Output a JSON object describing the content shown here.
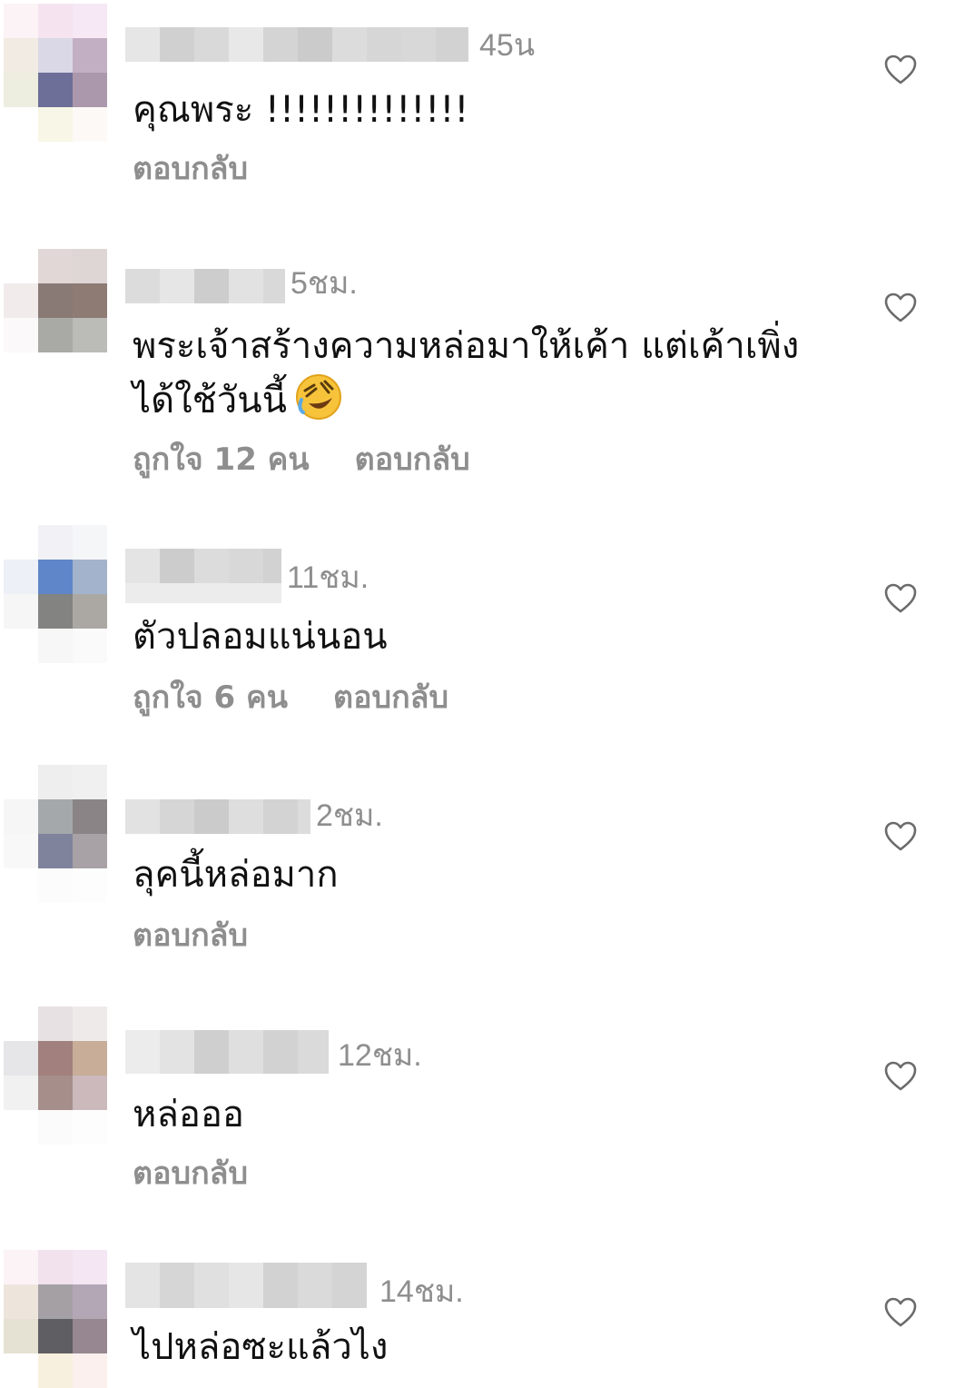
{
  "comments": [
    {
      "time": "45น",
      "text": "คุณพระ !!!!!!!!!!!!!!",
      "likes": "",
      "reply": "ตอบกลับ"
    },
    {
      "time": "5ชม.",
      "text_line1": "พระเจ้าสร้างความหล่อมาให้เค้า แต่เค้าเพิ่ง",
      "text_line2": "ได้ใช้วันนี้",
      "likes": "ถูกใจ 12 คน",
      "reply": "ตอบกลับ",
      "emoji": "rolling-on-floor-laughing-emoji"
    },
    {
      "time": "11ชม.",
      "text": "ตัวปลอมแน่นอน",
      "likes": "ถูกใจ 6 คน",
      "reply": "ตอบกลับ"
    },
    {
      "time": "2ชม.",
      "text": "ลุคนี้หล่อมาก",
      "likes": "",
      "reply": "ตอบกลับ"
    },
    {
      "time": "12ชม.",
      "text": "หล่อออ",
      "likes": "",
      "reply": "ตอบกลับ"
    },
    {
      "time": "14ชม.",
      "text": "ไปหล่อซะแล้วไง",
      "likes": "",
      "reply": ""
    }
  ],
  "icons": {
    "like": "heart-outline-icon"
  },
  "colors": {
    "meta_text": "#8e8e8e",
    "body_text": "#111111",
    "background": "#ffffff"
  }
}
